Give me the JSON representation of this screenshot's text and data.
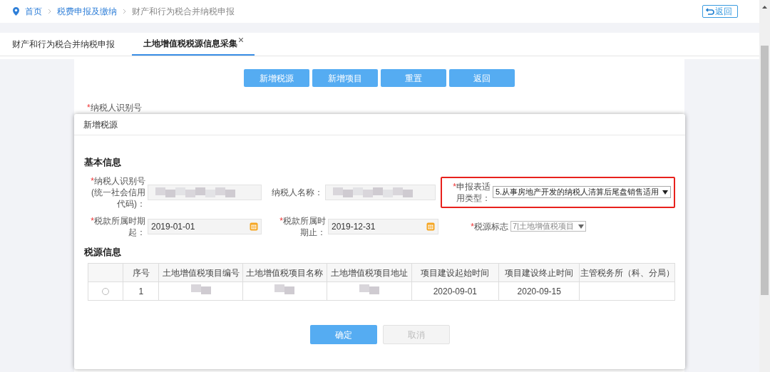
{
  "breadcrumb": [
    {
      "label": "首页",
      "kind": "home"
    },
    {
      "label": "税费申报及缴纳",
      "kind": "link"
    },
    {
      "label": "财产和行为税合并纳税申报",
      "kind": "current"
    }
  ],
  "back_button": "返回",
  "tabs": [
    {
      "label": "财产和行为税合并纳税申报",
      "selected": false,
      "closable": false
    },
    {
      "label": "土地增值税税源信息采集",
      "selected": true,
      "closable": true
    }
  ],
  "toolbar": [
    "新增税源",
    "新增项目",
    "重置",
    "返回"
  ],
  "required_mark": "*",
  "background_field": {
    "label": "纳税人识别号",
    "required": true
  },
  "dialog": {
    "title": "新增税源",
    "basic_info": {
      "heading": "基本信息",
      "fields": [
        {
          "kind": "redacted",
          "label": "纳税人识别号(统一社会信用代码)：",
          "required": true,
          "highlighted": false
        },
        {
          "kind": "redacted",
          "label": "纳税人名称：",
          "required": false,
          "highlighted": false
        },
        {
          "kind": "select",
          "label": "申报表适用类型：",
          "required": true,
          "value": "5.从事房地产开发的纳税人清算后尾盘销售适用",
          "highlighted": true
        },
        {
          "kind": "date",
          "label": "税款所属时期起：",
          "required": true,
          "value": "2019-01-01",
          "highlighted": false
        },
        {
          "kind": "date",
          "label": "税款所属时期止：",
          "required": true,
          "value": "2019-12-31",
          "highlighted": false
        },
        {
          "kind": "small-select",
          "label": "税源标志",
          "required": true,
          "value": "7|土地增值税项目",
          "highlighted": false
        }
      ]
    },
    "source_info": {
      "heading": "税源信息",
      "columns": [
        "序号",
        "土地增值税项目编号",
        "土地增值税项目名称",
        "土地增值税项目地址",
        "项目建设起始时间",
        "项目建设终止时间",
        "主管税务所（科、分局）"
      ],
      "rows": [
        {
          "selected": false,
          "cells": [
            {
              "kind": "text",
              "text": "1"
            },
            {
              "kind": "redacted"
            },
            {
              "kind": "redacted"
            },
            {
              "kind": "redacted"
            },
            {
              "kind": "text",
              "text": "2020-09-01"
            },
            {
              "kind": "text",
              "text": "2020-09-15"
            },
            {
              "kind": "empty"
            }
          ]
        }
      ]
    },
    "buttons": [
      {
        "label": "确定",
        "disabled": false
      },
      {
        "label": "取消",
        "disabled": true
      }
    ]
  }
}
